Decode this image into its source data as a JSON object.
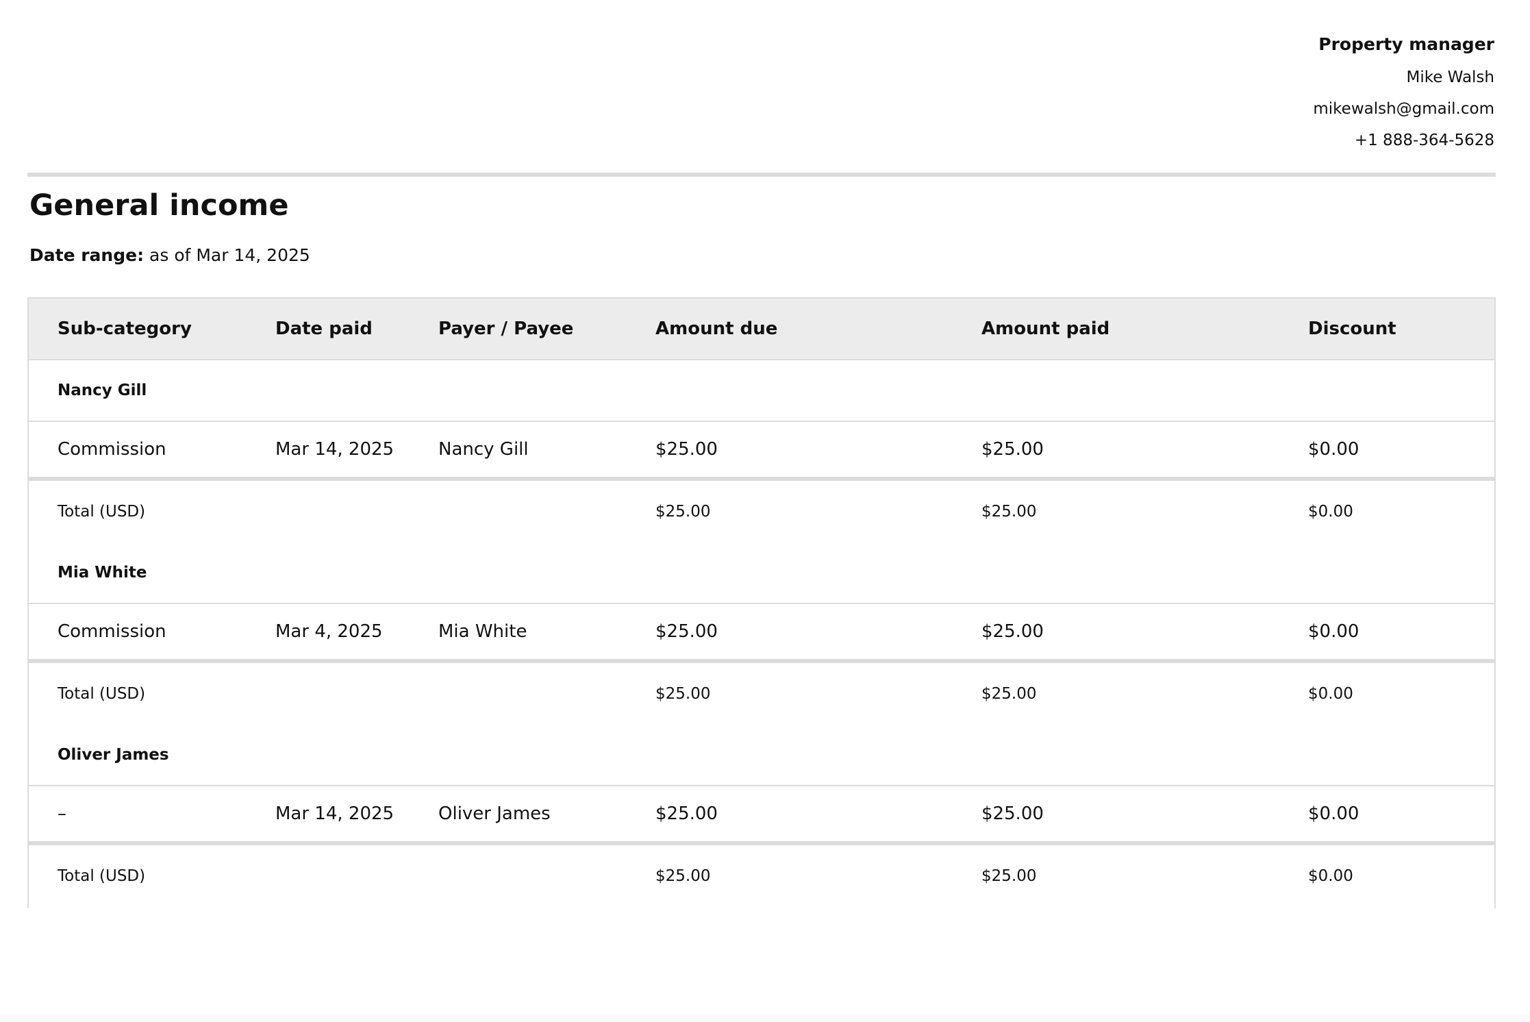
{
  "manager": {
    "label": "Property manager",
    "name": "Mike Walsh",
    "email": "mikewalsh@gmail.com",
    "phone": "+1 888-364-5628"
  },
  "report": {
    "title": "General income",
    "date_range_label": "Date range:",
    "date_range_value": "as of Mar 14, 2025"
  },
  "table": {
    "columns": [
      "Sub-category",
      "Date paid",
      "Payer / Payee",
      "Amount due",
      "Amount paid",
      "Discount"
    ],
    "groups": [
      {
        "name": "Nancy Gill",
        "rows": [
          {
            "sub_category": "Commission",
            "date_paid": "Mar 14, 2025",
            "payer": "Nancy Gill",
            "amount_due": "$25.00",
            "amount_paid": "$25.00",
            "discount": "$0.00"
          }
        ],
        "total": {
          "label": "Total (USD)",
          "amount_due": "$25.00",
          "amount_paid": "$25.00",
          "discount": "$0.00"
        }
      },
      {
        "name": "Mia White",
        "rows": [
          {
            "sub_category": "Commission",
            "date_paid": "Mar 4, 2025",
            "payer": "Mia White",
            "amount_due": "$25.00",
            "amount_paid": "$25.00",
            "discount": "$0.00"
          }
        ],
        "total": {
          "label": "Total (USD)",
          "amount_due": "$25.00",
          "amount_paid": "$25.00",
          "discount": "$0.00"
        }
      },
      {
        "name": "Oliver James",
        "rows": [
          {
            "sub_category": "–",
            "date_paid": "Mar 14, 2025",
            "payer": "Oliver James",
            "amount_due": "$25.00",
            "amount_paid": "$25.00",
            "discount": "$0.00"
          }
        ],
        "total": {
          "label": "Total (USD)",
          "amount_due": "$25.00",
          "amount_paid": "$25.00",
          "discount": "$0.00"
        }
      }
    ]
  }
}
